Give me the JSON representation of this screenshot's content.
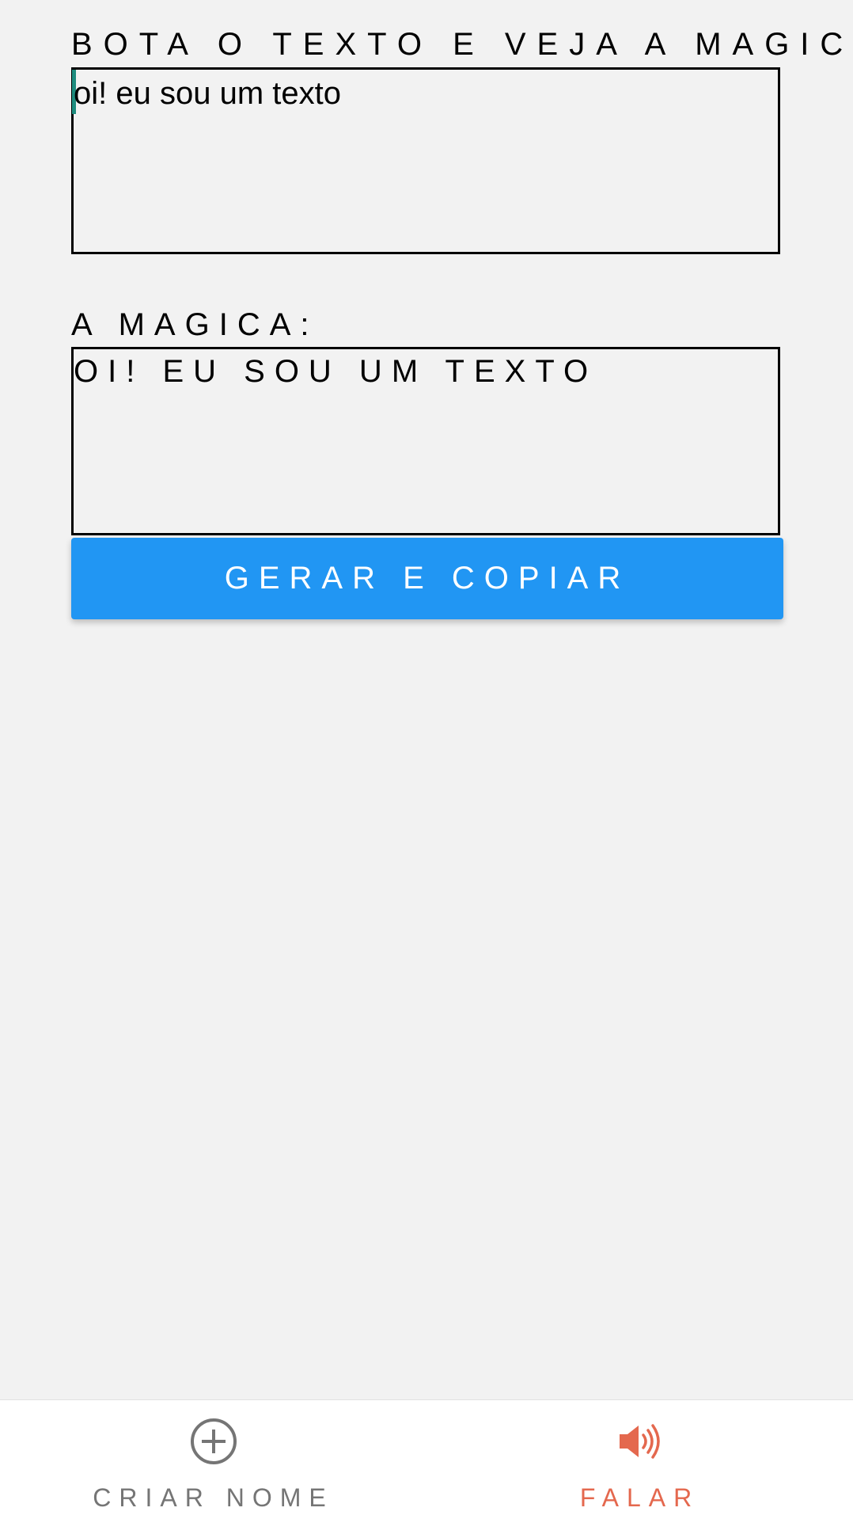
{
  "input_section": {
    "label": "BOTA O TEXTO E VEJA A MAGICA",
    "value": "oi! eu sou um texto"
  },
  "output_section": {
    "label": "A MAGICA:",
    "value": "OI! EU SOU UM TEXTO"
  },
  "actions": {
    "generate_copy_label": "GERAR E COPIAR"
  },
  "bottom_nav": {
    "items": [
      {
        "label": "CRIAR NOME",
        "icon": "plus-circle-icon",
        "active": false
      },
      {
        "label": "FALAR",
        "icon": "speaker-icon",
        "active": true
      }
    ]
  },
  "colors": {
    "background": "#f2f2f2",
    "button": "#2196f3",
    "active_tab": "#e4684e",
    "inactive_tab": "#757575",
    "caret": "#1e8c7e"
  }
}
